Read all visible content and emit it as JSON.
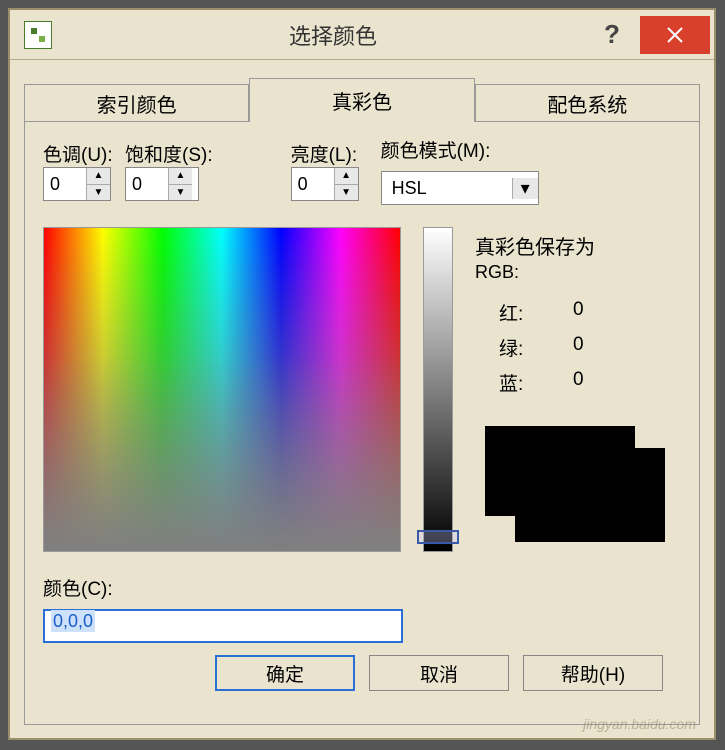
{
  "title": "选择颜色",
  "tabs": {
    "index": "索引颜色",
    "truecolor": "真彩色",
    "scheme": "配色系统"
  },
  "labels": {
    "hue": "色调(U):",
    "sat": "饱和度(S):",
    "light": "亮度(L):",
    "mode": "颜色模式(M):",
    "saveas": "真彩色保存为",
    "rgb": "RGB:",
    "red": "红:",
    "green": "绿:",
    "blue": "蓝:",
    "color": "颜色(C):"
  },
  "values": {
    "hue": "0",
    "sat": "0",
    "light": "0",
    "mode": "HSL",
    "red": "0",
    "green": "0",
    "blue": "0",
    "color_text": "0,0,0"
  },
  "buttons": {
    "ok": "确定",
    "cancel": "取消",
    "help": "帮助(H)"
  }
}
